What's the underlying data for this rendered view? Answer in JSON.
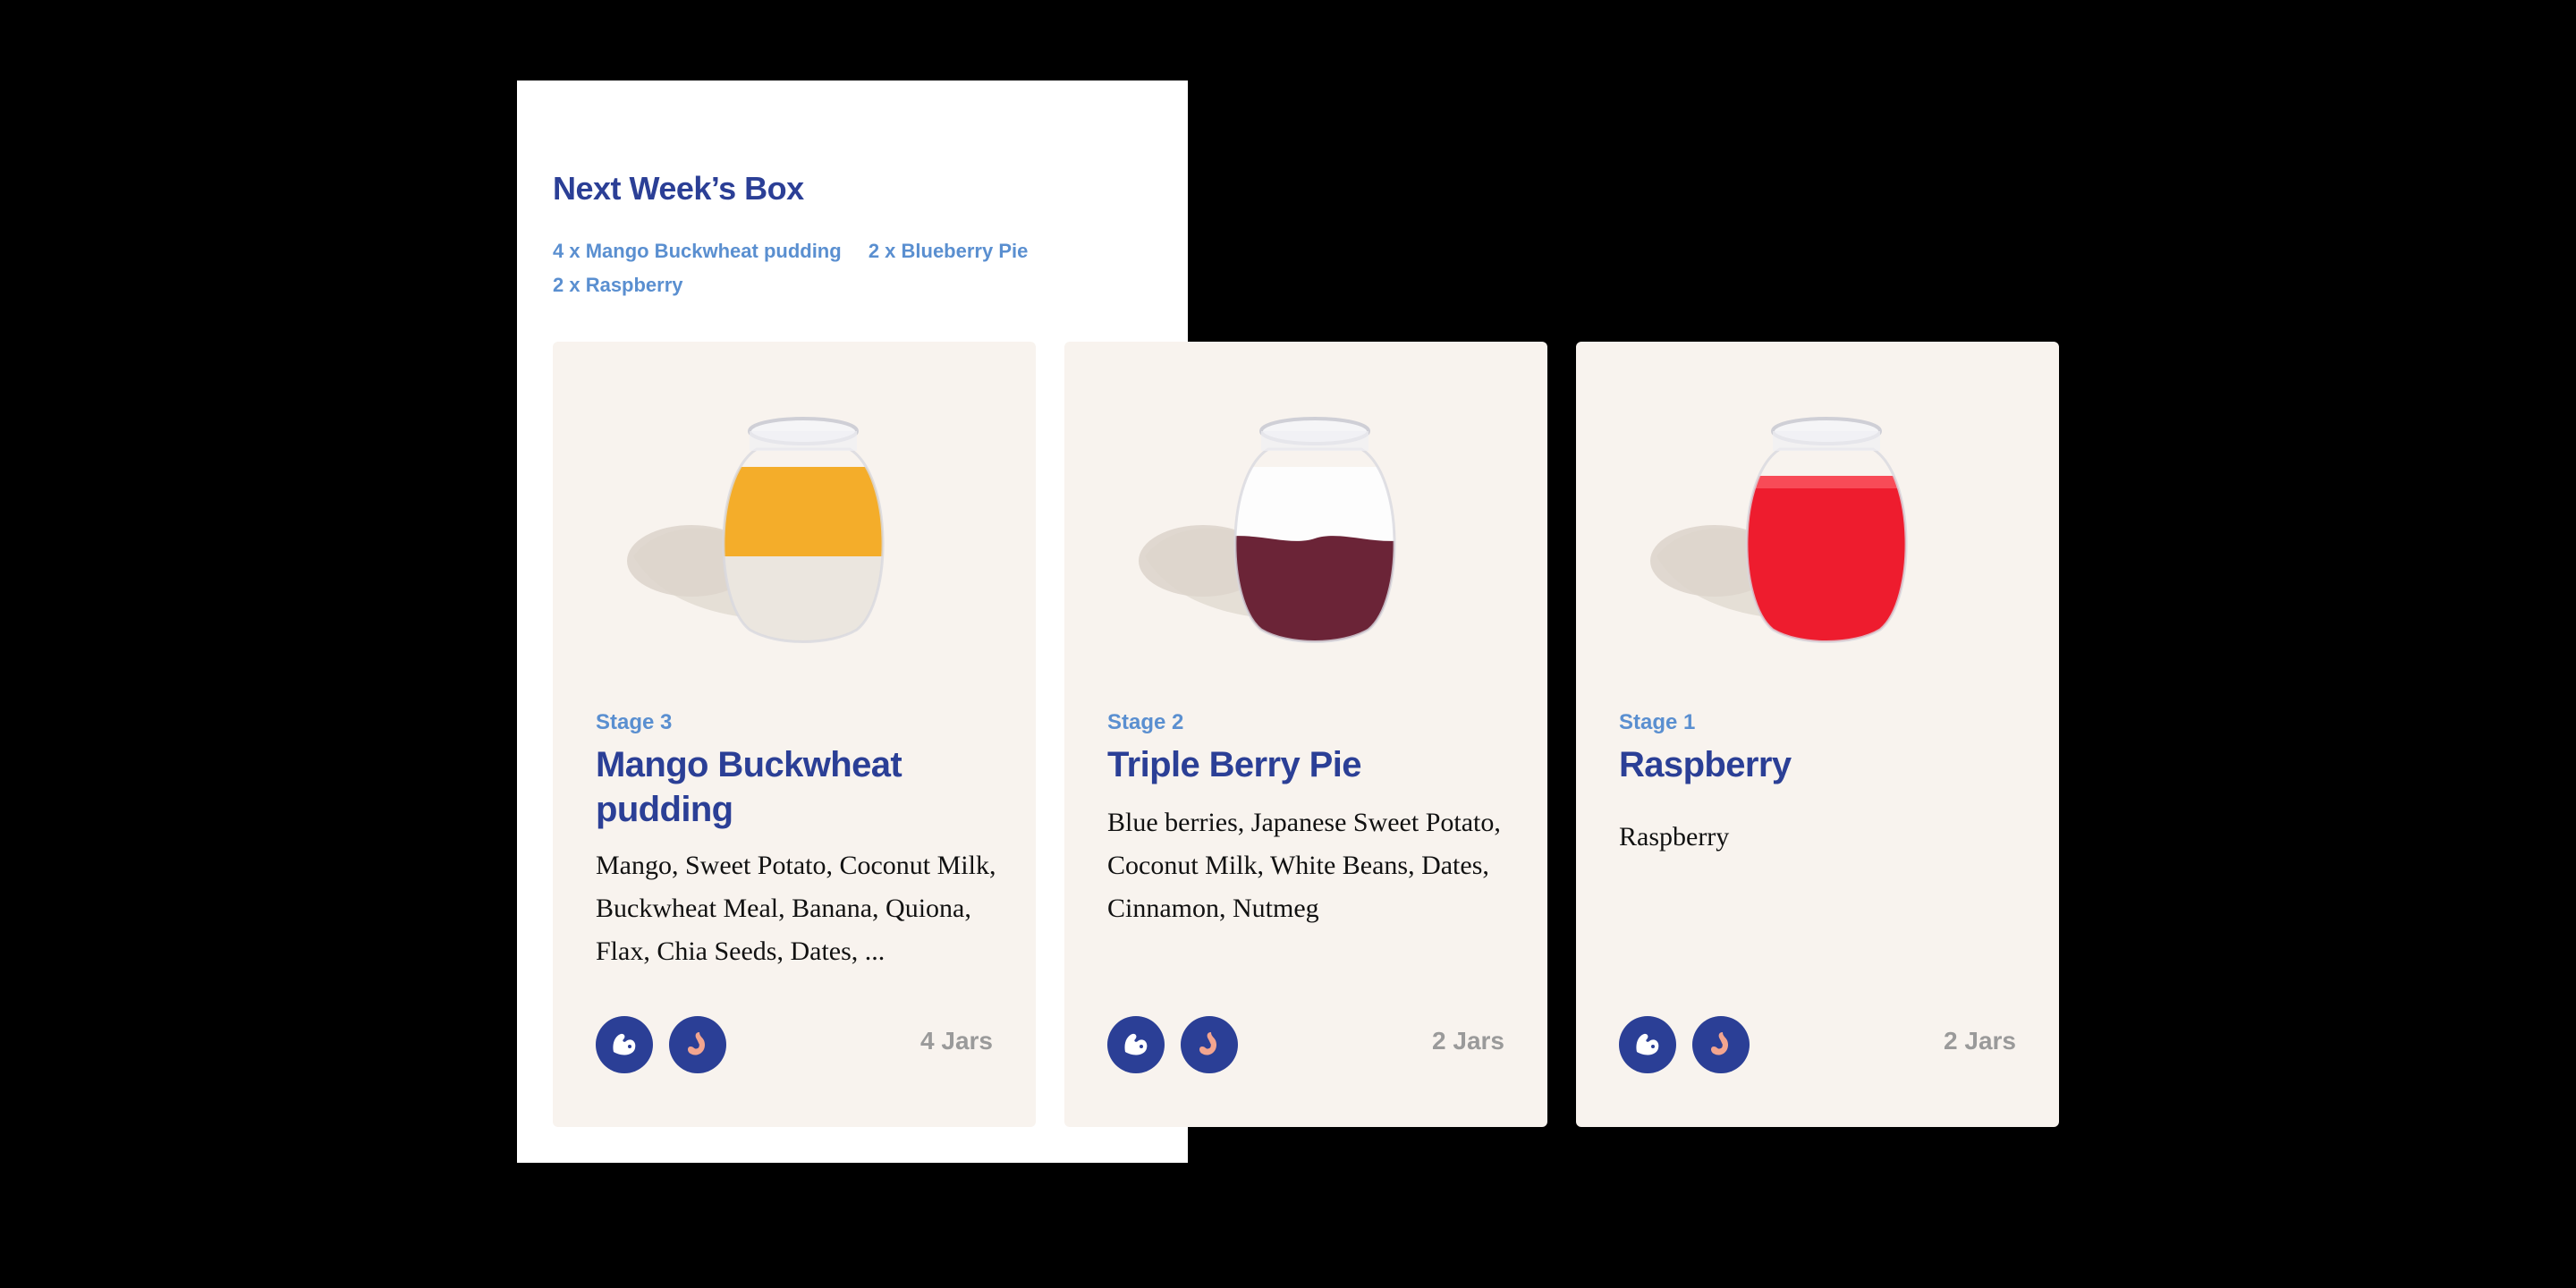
{
  "box": {
    "title": "Next Week’s Box",
    "summary": [
      "4 x Mango Buckwheat pudding",
      "2 x Blueberry Pie",
      "2 x Raspberry"
    ]
  },
  "cards": [
    {
      "stage": "Stage 3",
      "name": "Mango Buckwheat pudding",
      "ingredients": "Mango, Sweet Potato, Coconut Milk, Buckwheat Meal, Banana, Quiona, Flax, Chia Seeds, Dates, ...",
      "jars": "4 Jars",
      "jar_top_color": "#f4ad2a",
      "jar_bottom_color": "#ebe6df",
      "badges": [
        "strength-icon",
        "tummy-icon"
      ]
    },
    {
      "stage": "Stage 2",
      "name": "Triple Berry Pie",
      "ingredients": "Blue berries, Japanese Sweet Potato, Coconut Milk, White Beans, Dates, Cinnamon, Nutmeg",
      "jars": "2 Jars",
      "jar_top_color": "#fdfdfd",
      "jar_bottom_color": "#6b2437",
      "badges": [
        "strength-icon",
        "tummy-icon"
      ]
    },
    {
      "stage": "Stage 1",
      "name": "Raspberry",
      "ingredients": "Raspberry",
      "jars": "2 Jars",
      "jar_top_color": "#ee1c2e",
      "jar_bottom_color": "#ee1c2e",
      "badges": [
        "strength-icon",
        "tummy-icon"
      ]
    }
  ],
  "colors": {
    "background": "#000000",
    "panel": "#ffffff",
    "card": "#f8f3ee",
    "title": "#2b3f96",
    "accent": "#5a8fd0",
    "muted": "#9a9a9a"
  }
}
